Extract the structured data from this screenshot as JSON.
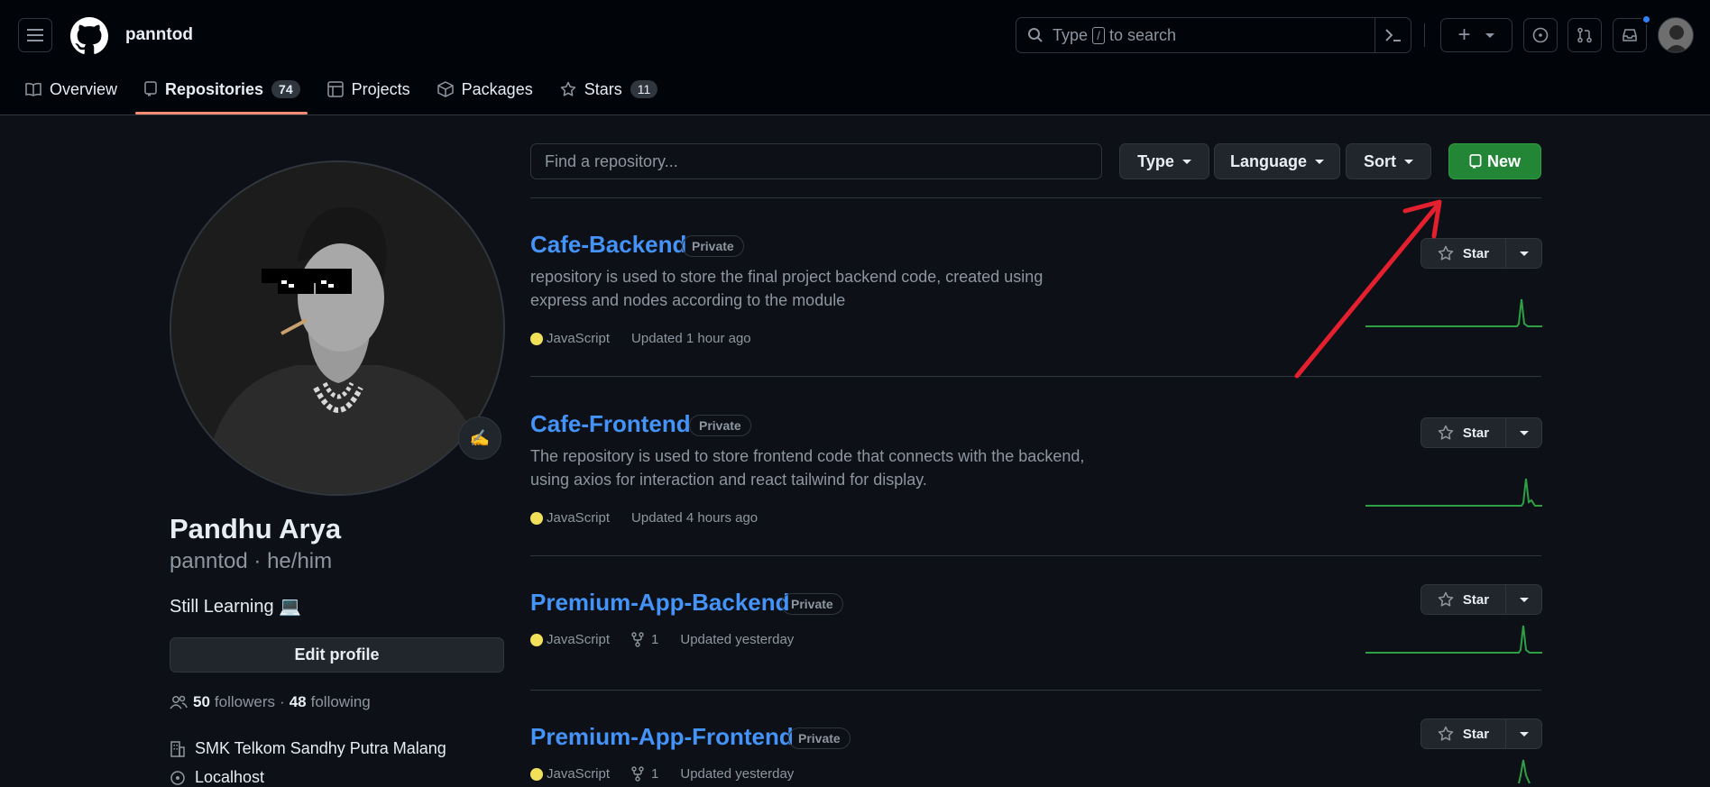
{
  "header": {
    "username": "panntod",
    "search_prefix": "Type",
    "search_key": "/",
    "search_suffix": "to search",
    "plus_label": "+"
  },
  "tabs": [
    {
      "label": "Overview",
      "icon": "book-icon"
    },
    {
      "label": "Repositories",
      "count": "74",
      "icon": "repo-icon"
    },
    {
      "label": "Projects",
      "icon": "table-icon"
    },
    {
      "label": "Packages",
      "icon": "package-icon"
    },
    {
      "label": "Stars",
      "count": "11",
      "icon": "star-icon"
    }
  ],
  "profile": {
    "name": "Pandhu Arya",
    "handle": "panntod · he/him",
    "bio": "Still Learning 💻",
    "emoji": "✍",
    "edit_label": "Edit profile",
    "followers": "50",
    "followers_label": "followers",
    "separator": "·",
    "following": "48",
    "following_label": "following",
    "organization": "SMK Telkom Sandhy Putra Malang",
    "location": "Localhost"
  },
  "toolbar": {
    "find_placeholder": "Find a repository...",
    "type_label": "Type",
    "language_label": "Language",
    "sort_label": "Sort",
    "new_label": "New"
  },
  "repos": [
    {
      "name": "Cafe-Backend",
      "visibility": "Private",
      "description": "repository is used to store the final project backend code, created using express and nodes according to the module",
      "language": "JavaScript",
      "updated": "Updated 1 hour ago",
      "star_label": "Star"
    },
    {
      "name": "Cafe-Frontend",
      "visibility": "Private",
      "description": "The repository is used to store frontend code that connects with the backend, using axios for interaction and react tailwind for display.",
      "language": "JavaScript",
      "updated": "Updated 4 hours ago",
      "star_label": "Star"
    },
    {
      "name": "Premium-App-Backend",
      "visibility": "Private",
      "language": "JavaScript",
      "forks": "1",
      "updated": "Updated yesterday",
      "star_label": "Star"
    },
    {
      "name": "Premium-App-Frontend",
      "visibility": "Private",
      "language": "JavaScript",
      "forks": "1",
      "updated": "Updated yesterday",
      "star_label": "Star"
    }
  ],
  "colors": {
    "accent_link": "#4493f8",
    "new_button": "#238636",
    "tab_underline": "#fd8c73",
    "javascript": "#f1e05a",
    "sparkline": "#2ea043",
    "annotation_arrow": "#e5202e"
  }
}
